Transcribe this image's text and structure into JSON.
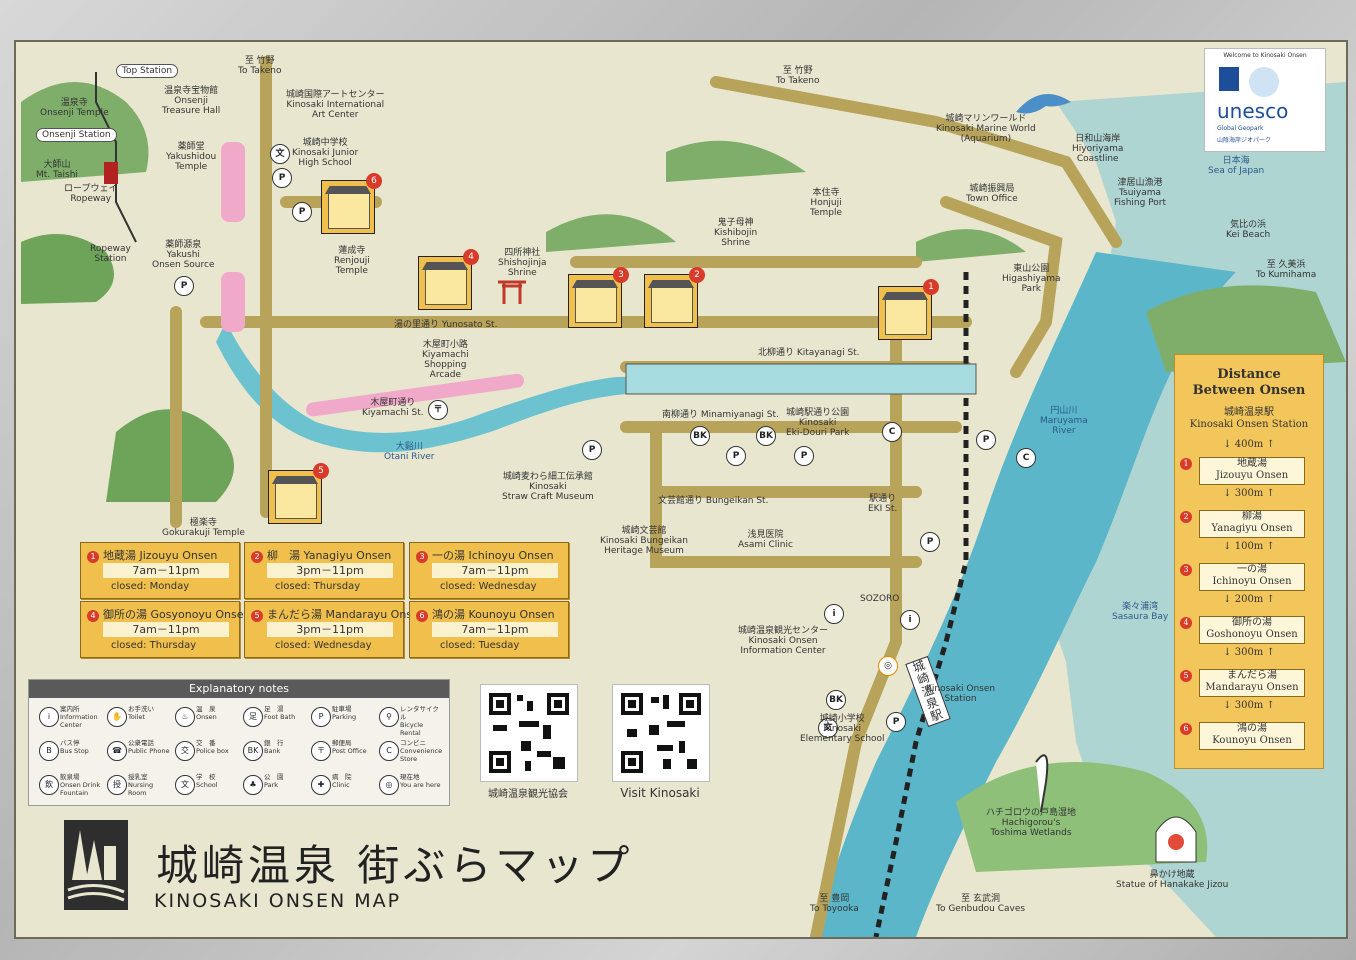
{
  "map": {
    "title_jp": "城崎温泉 街ぶらマップ",
    "title_en": "KINOSAKI ONSEN MAP",
    "unesco": {
      "welcome": "Welcome to Kinosaki Onsen",
      "name": "unesco",
      "sub": "Global Geopark",
      "sub2": "山陰海岸ジオパーク"
    },
    "labels": {
      "top_station": "Top Station",
      "onsenji_temple": "温泉寺\nOnsenji Temple",
      "onsenji_station": "Onsenji Station",
      "mt_taishi": "大師山\nMt. Taishi",
      "treasure_hall": "温泉寺宝物館\nOnsenji\nTreasure  Hall",
      "yakushidou": "薬師堂\nYakushidou\nTemple",
      "ropeway": "ロープウェイ\nRopeway",
      "ropeway_station": "Ropeway\nStation",
      "yakushi_source": "薬師源泉\nYakushi\nOnsen Source",
      "to_takeno_1": "至 竹野\nTo Takeno",
      "to_takeno_2": "至 竹野\nTo Takeno",
      "art_center": "城崎国際アートセンター\nKinosaki International\nArt Center",
      "junior_high": "城崎中学校\nKinosaki Junior\nHigh School",
      "renjouji": "蓮成寺\nRenjouji\nTemple",
      "shishojinja": "四所神社\nShishojinja\nShrine",
      "kishibojin": "鬼子母神\nKishibojin\nShrine",
      "honjuji": "本住寺\nHonjuji\nTemple",
      "town_office": "城崎振興局\nTown Office",
      "marine_world": "城崎マリンワールド\nKinosaki Marine World\n(Aquarium)",
      "hiyoriyama": "日和山海岸\nHiyoriyama\nCoastline",
      "fishing_port": "津居山漁港\nTsuiyama\nFishing Port",
      "sea_of_japan": "日本海\nSea of Japan",
      "kei_beach": "気比の浜\nKei Beach",
      "to_kumihama": "至 久美浜\nTo Kumihama",
      "higashiyama": "東山公園\nHigashiyama\nPark",
      "yunosato": "湯の里通り Yunosato St.",
      "kitayanagi": "北柳通り Kitayanagi St.",
      "minamiyanagi": "南柳通り Minamiyanagi St.",
      "kiyamachi_arcade": "木屋町小路\nKiyamachi\nShopping\nArcade",
      "kiyamachi_st": "木屋町通り\nKiyamachi St.",
      "otani_river": "大谿川\nOtani River",
      "ekidouri_park": "城崎駅通り公園\nKinosaki\nEki-Douri Park",
      "straw_craft": "城崎麦わら細工伝承館\nKinosaki\nStraw Craft Museum",
      "bungeikan_st": "文芸館通り Bungeikan St.",
      "bungeikan": "城崎文芸館\nKinosaki Bungeikan\nHeritage Museum",
      "asami": "浅見医院\nAsami Clinic",
      "eki_st": "駅通り\nEKI St.",
      "gokurakuji": "極楽寺\nGokurakuji Temple",
      "maruyama": "円山川\nMaruyama\nRiver",
      "sasaura": "楽々浦湾\nSasaura Bay",
      "sozoro": "SOZORO",
      "info_center": "城崎温泉観光センター\nKinosaki Onsen\nInformation Center",
      "station_jp": "城崎温泉駅",
      "station_en": "Kinosaki Onsen\nStation",
      "elementary": "城崎小学校\nKinosaki\nElementary School",
      "hachigorou": "ハチゴロウの戸島湿地\nHachigorou's\nToshima Wetlands",
      "hanakake": "鼻かけ地蔵\nStatue of Hanakake Jizou",
      "to_toyooka": "至 豊岡\nTo Toyooka",
      "to_genbudou": "至 玄武洞\nTo Genbudou Caves",
      "qr1": "城崎温泉観光協会",
      "qr2": "Visit Kinosaki"
    },
    "onsens": [
      {
        "num": "1",
        "name": "地蔵湯  Jizouyu Onsen",
        "hours": "7am－11pm",
        "closed": "closed: Monday"
      },
      {
        "num": "2",
        "name": "柳　湯  Yanagiyu Onsen",
        "hours": "3pm－11pm",
        "closed": "closed: Thursday"
      },
      {
        "num": "3",
        "name": "一の湯  Ichinoyu Onsen",
        "hours": "7am－11pm",
        "closed": "closed: Wednesday"
      },
      {
        "num": "4",
        "name": "御所の湯  Gosyonoyu Onsen",
        "hours": "7am－11pm",
        "closed": "closed: Thursday"
      },
      {
        "num": "5",
        "name": "まんだら湯  Mandarayu Onsen",
        "hours": "3pm－11pm",
        "closed": "closed: Wednesday"
      },
      {
        "num": "6",
        "name": "鴻の湯  Kounoyu Onsen",
        "hours": "7am－11pm",
        "closed": "closed: Tuesday"
      }
    ],
    "notes": {
      "title": "Explanatory notes",
      "items": [
        {
          "icon": "i",
          "text": "案内所\nInformation\nCenter"
        },
        {
          "icon": "✋",
          "text": "お手洗い\nToilet"
        },
        {
          "icon": "♨",
          "text": "温　泉\nOnsen"
        },
        {
          "icon": "足",
          "text": "足　湯\nFoot Bath"
        },
        {
          "icon": "P",
          "text": "駐車場\nParking"
        },
        {
          "icon": "⚲",
          "text": "レンタサイクル\nBicycle Rental"
        },
        {
          "icon": "B",
          "text": "バス停\nBus Stop"
        },
        {
          "icon": "☎",
          "text": "公衆電話\nPublic Phone"
        },
        {
          "icon": "交",
          "text": "交　番\nPolice box"
        },
        {
          "icon": "BK",
          "text": "銀　行\nBank"
        },
        {
          "icon": "〒",
          "text": "郵便局\nPost Office"
        },
        {
          "icon": "C",
          "text": "コンビニ\nConvenience\nStore"
        },
        {
          "icon": "飲",
          "text": "飲泉場\nOnsen Drink\nFountain"
        },
        {
          "icon": "授",
          "text": "授乳室\nNursing\nRoom"
        },
        {
          "icon": "文",
          "text": "学　校\nSchool"
        },
        {
          "icon": "♣",
          "text": "公　園\nPark"
        },
        {
          "icon": "✚",
          "text": "病　院\nClinic"
        },
        {
          "icon": "◎",
          "text": "現在地\nYou are here"
        }
      ]
    },
    "distance": {
      "title": "Distance\nBetween Onsen",
      "station": "城崎温泉駅\nKinosaki Onsen Station",
      "first_gap": "↓ 400m ↑",
      "items": [
        {
          "num": "1",
          "text": "地蔵湯\nJizouyu Onsen",
          "gap": "↓ 300m ↑"
        },
        {
          "num": "2",
          "text": "柳湯\nYanagiyu Onsen",
          "gap": "↓ 100m ↑"
        },
        {
          "num": "3",
          "text": "一の湯\nIchinoyu Onsen",
          "gap": "↓ 200m ↑"
        },
        {
          "num": "4",
          "text": "御所の湯\nGoshonoyu Onsen",
          "gap": "↓ 300m ↑"
        },
        {
          "num": "5",
          "text": "まんだら湯\nMandarayu Onsen",
          "gap": "↓ 300m ↑"
        },
        {
          "num": "6",
          "text": "鴻の湯\nKounoyu Onsen",
          "gap": ""
        }
      ]
    },
    "colors": {
      "board": "#e9e6cf",
      "road": "#b8a35a",
      "river": "#5bb6c9",
      "hill": "#7fae6a",
      "onsen_box": "#f1c04c",
      "marker_red": "#d93b2b"
    }
  }
}
